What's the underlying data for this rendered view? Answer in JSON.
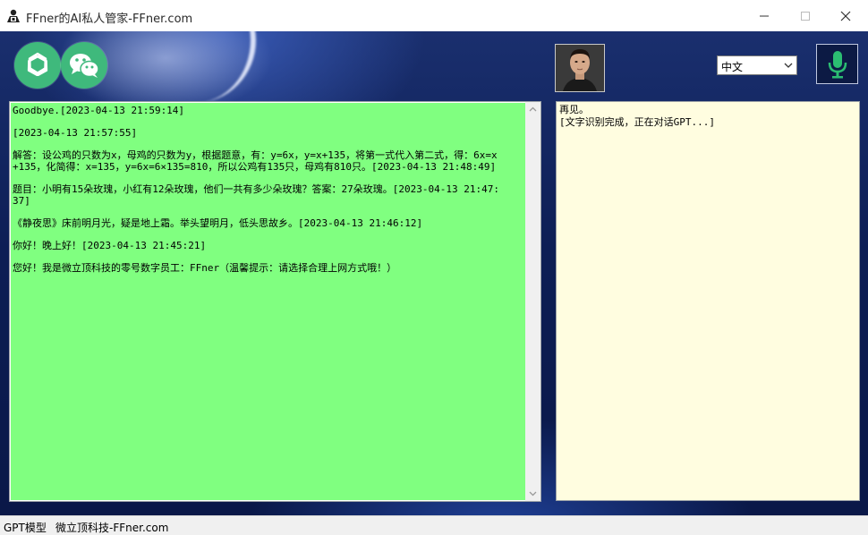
{
  "window": {
    "title": "FFner的AI私人管家-FFner.com"
  },
  "toolbar": {
    "openai_icon": "openai-logo-icon",
    "wechat_icon": "wechat-icon",
    "avatar": "digital-employee-avatar",
    "language": {
      "selected": "中文"
    },
    "mic_icon": "microphone-icon",
    "accent_color": "#3fb97c"
  },
  "chat_log": {
    "background": "#80ff80",
    "messages": [
      "Goodbye.[2023-04-13 21:59:14]",
      "[2023-04-13 21:57:55]",
      "解答：设公鸡的只数为x，母鸡的只数为y，根据题意，有：y=6x，y=x+135，将第一式代入第二式，得：6x=x+135，化简得：x=135，y=6x=6×135=810，所以公鸡有135只，母鸡有810只。[2023-04-13 21:48:49]",
      "题目：小明有15朵玫瑰，小红有12朵玫瑰，他们一共有多少朵玫瑰？答案：27朵玫瑰。[2023-04-13 21:47:37]",
      "《静夜思》床前明月光，疑是地上霜。举头望明月，低头思故乡。[2023-04-13 21:46:12]",
      "你好！晚上好！[2023-04-13 21:45:21]",
      "您好！我是微立顶科技的零号数字员工：FFner（温馨提示：请选择合理上网方式哦！）"
    ]
  },
  "status_panel": {
    "background": "#fffde0",
    "lines": [
      "再见。",
      "[文字识别完成，正在对话GPT...]"
    ]
  },
  "statusbar": {
    "model": "GPT模型",
    "company": "微立顶科技-FFner.com"
  }
}
